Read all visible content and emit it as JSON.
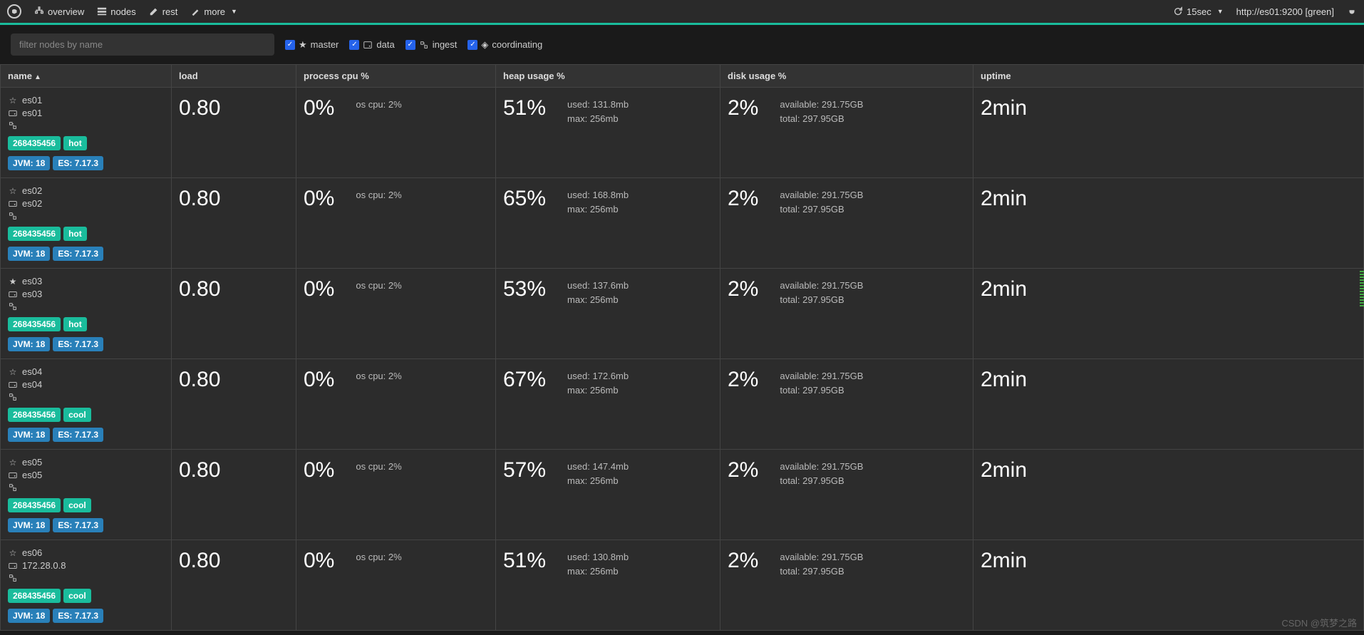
{
  "nav": {
    "overview": "overview",
    "nodes": "nodes",
    "rest": "rest",
    "more": "more",
    "refresh": "15sec",
    "cluster": "http://es01:9200 [green]"
  },
  "filter": {
    "placeholder": "filter nodes by name",
    "master": "master",
    "data": "data",
    "ingest": "ingest",
    "coordinating": "coordinating"
  },
  "headers": {
    "name": "name",
    "load": "load",
    "cpu": "process cpu %",
    "heap": "heap usage %",
    "disk": "disk usage %",
    "uptime": "uptime"
  },
  "nodes": [
    {
      "name": "es01",
      "host": "es01",
      "master": false,
      "load": "0.80",
      "cpu": "0%",
      "oscpu": "os cpu: 2%",
      "heap": "51%",
      "heap_used": "used: 131.8mb",
      "heap_max": "max: 256mb",
      "disk": "2%",
      "disk_avail": "available: 291.75GB",
      "disk_total": "total: 297.95GB",
      "uptime": "2min",
      "mem": "268435456",
      "tier": "hot",
      "jvm": "JVM: 18",
      "es": "ES: 7.17.3"
    },
    {
      "name": "es02",
      "host": "es02",
      "master": false,
      "load": "0.80",
      "cpu": "0%",
      "oscpu": "os cpu: 2%",
      "heap": "65%",
      "heap_used": "used: 168.8mb",
      "heap_max": "max: 256mb",
      "disk": "2%",
      "disk_avail": "available: 291.75GB",
      "disk_total": "total: 297.95GB",
      "uptime": "2min",
      "mem": "268435456",
      "tier": "hot",
      "jvm": "JVM: 18",
      "es": "ES: 7.17.3"
    },
    {
      "name": "es03",
      "host": "es03",
      "master": true,
      "load": "0.80",
      "cpu": "0%",
      "oscpu": "os cpu: 2%",
      "heap": "53%",
      "heap_used": "used: 137.6mb",
      "heap_max": "max: 256mb",
      "disk": "2%",
      "disk_avail": "available: 291.75GB",
      "disk_total": "total: 297.95GB",
      "uptime": "2min",
      "mem": "268435456",
      "tier": "hot",
      "jvm": "JVM: 18",
      "es": "ES: 7.17.3"
    },
    {
      "name": "es04",
      "host": "es04",
      "master": false,
      "load": "0.80",
      "cpu": "0%",
      "oscpu": "os cpu: 2%",
      "heap": "67%",
      "heap_used": "used: 172.6mb",
      "heap_max": "max: 256mb",
      "disk": "2%",
      "disk_avail": "available: 291.75GB",
      "disk_total": "total: 297.95GB",
      "uptime": "2min",
      "mem": "268435456",
      "tier": "cool",
      "jvm": "JVM: 18",
      "es": "ES: 7.17.3"
    },
    {
      "name": "es05",
      "host": "es05",
      "master": false,
      "load": "0.80",
      "cpu": "0%",
      "oscpu": "os cpu: 2%",
      "heap": "57%",
      "heap_used": "used: 147.4mb",
      "heap_max": "max: 256mb",
      "disk": "2%",
      "disk_avail": "available: 291.75GB",
      "disk_total": "total: 297.95GB",
      "uptime": "2min",
      "mem": "268435456",
      "tier": "cool",
      "jvm": "JVM: 18",
      "es": "ES: 7.17.3"
    },
    {
      "name": "es06",
      "host": "172.28.0.8",
      "master": false,
      "load": "0.80",
      "cpu": "0%",
      "oscpu": "os cpu: 2%",
      "heap": "51%",
      "heap_used": "used: 130.8mb",
      "heap_max": "max: 256mb",
      "disk": "2%",
      "disk_avail": "available: 291.75GB",
      "disk_total": "total: 297.95GB",
      "uptime": "2min",
      "mem": "268435456",
      "tier": "cool",
      "jvm": "JVM: 18",
      "es": "ES: 7.17.3"
    }
  ],
  "watermark": "CSDN @筑梦之路"
}
